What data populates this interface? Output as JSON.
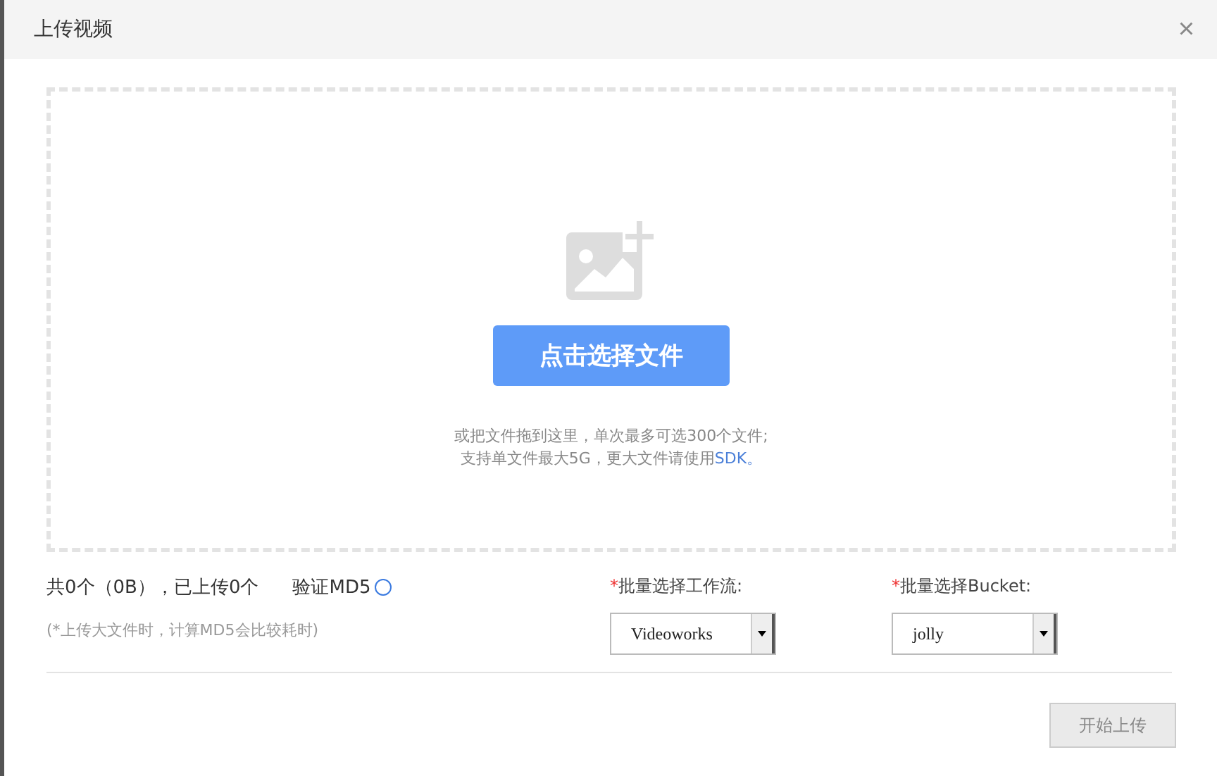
{
  "dialog": {
    "title": "上传视频",
    "close": "×"
  },
  "dropzone": {
    "button": "点击选择文件",
    "hint_line_1": "或把文件拖到这里，单次最多可选300个文件;",
    "hint_line_2": "支持单文件最大5G，更大文件请使用",
    "hint_link": "SDK。"
  },
  "summary": {
    "text": "共0个（0B），已上传0个",
    "md5_label": "验证MD5",
    "md5_checked": false,
    "note": "(*上传大文件时，计算MD5会比较耗时)"
  },
  "selects": [
    {
      "required_mark": "*",
      "label": "批量选择工作流:",
      "value": "Videoworks"
    },
    {
      "required_mark": "*",
      "label": "批量选择Bucket:",
      "value": "jolly"
    }
  ],
  "start_button": {
    "label": "开始上传",
    "disabled": true
  }
}
